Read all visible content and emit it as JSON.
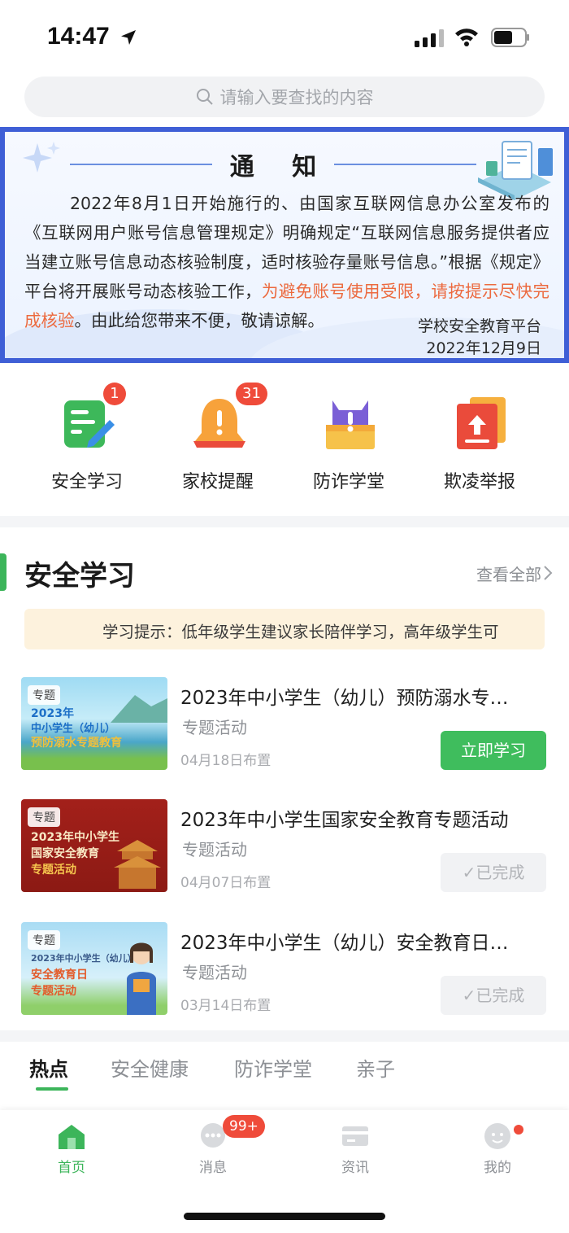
{
  "status_bar": {
    "time": "14:47"
  },
  "search": {
    "placeholder": "请输入要查找的内容"
  },
  "notice": {
    "title": "通  知",
    "body_plain": "2022年8月1日开始施行的、由国家互联网信息办公室发布的《互联网用户账号信息管理规定》明确规定“互联网信息服务提供者应当建立账号信息动态核验制度，适时核验存量账号信息。”根据《规定》平台将开展账号动态核验工作，",
    "body_highlight": "为避免账号使用受限，请按提示尽快完成核验",
    "body_tail": "。由此给您带来不便，敬请谅解。",
    "sign_org": "学校安全教育平台",
    "sign_date": "2022年12月9日",
    "highlight_color": "#ec6a3f",
    "border_color": "#3f5fd6"
  },
  "entries": [
    {
      "label": "安全学习",
      "badge": "1",
      "icon": "safety-study-icon"
    },
    {
      "label": "家校提醒",
      "badge": "31",
      "icon": "bell-icon"
    },
    {
      "label": "防诈学堂",
      "badge": "",
      "icon": "anti-fraud-icon"
    },
    {
      "label": "欺凌举报",
      "badge": "",
      "icon": "report-icon"
    }
  ],
  "section": {
    "title": "安全学习",
    "more_label": "查看全部",
    "tip": "学习提示：低年级学生建议家长陪伴学习，高年级学生可"
  },
  "courses": [
    {
      "title": "2023年中小学生（幼儿）预防溺水专…",
      "subtitle": "专题活动",
      "date": "04月18日布置",
      "action": "立即学习",
      "status": "todo",
      "thumb_tag": "专题",
      "thumb_lines": [
        "2023年",
        "中小学生（幼儿）",
        "预防溺水专题教育"
      ]
    },
    {
      "title": "2023年中小学生国家安全教育专题活动",
      "subtitle": "专题活动",
      "date": "04月07日布置",
      "action": "✓已完成",
      "status": "done",
      "thumb_tag": "专题",
      "thumb_lines": [
        "2023年中小学生",
        "国家安全教育",
        "专题活动"
      ]
    },
    {
      "title": "2023年中小学生（幼儿）安全教育日…",
      "subtitle": "专题活动",
      "date": "03月14日布置",
      "action": "✓已完成",
      "status": "done",
      "thumb_tag": "专题",
      "thumb_lines": [
        "2023年中小学生（幼儿）",
        "安全教育日",
        "专题活动"
      ]
    }
  ],
  "category_tabs": [
    "热点",
    "安全健康",
    "防诈学堂",
    "亲子"
  ],
  "bottom_nav": [
    {
      "label": "首页",
      "icon": "home-icon",
      "active": true,
      "badge": ""
    },
    {
      "label": "消息",
      "icon": "message-icon",
      "active": false,
      "badge": "99+"
    },
    {
      "label": "资讯",
      "icon": "news-icon",
      "active": false,
      "badge": ""
    },
    {
      "label": "我的",
      "icon": "profile-icon",
      "active": false,
      "badge": "dot"
    }
  ],
  "colors": {
    "brand_green": "#3cb55a",
    "badge_red": "#ef4b3a"
  }
}
